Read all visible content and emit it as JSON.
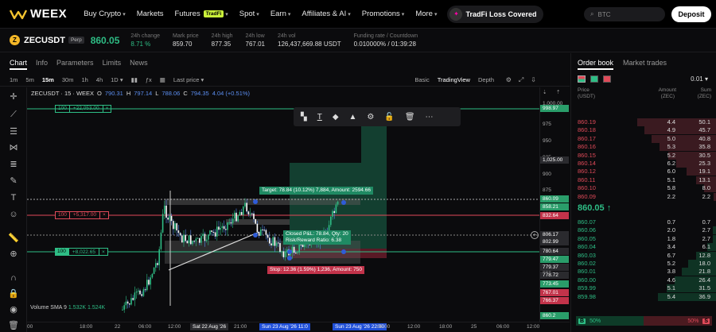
{
  "brand": {
    "name": "WEEX"
  },
  "nav": {
    "items": [
      "Buy Crypto",
      "Markets",
      "Futures",
      "Spot",
      "Earn",
      "Affiliates & AI",
      "Promotions",
      "More"
    ],
    "futures_badge": "TradFi",
    "promo": "TradFi Loss Covered",
    "search_placeholder": "BTC",
    "deposit": "Deposit"
  },
  "ticker": {
    "symbol": "ZECUSDT",
    "badge": "Perp",
    "last_price": "860.05",
    "stats": [
      {
        "label": "24h change",
        "value": "8.71 %"
      },
      {
        "label": "Mark price",
        "value": "859.70"
      },
      {
        "label": "24h high",
        "value": "877.35"
      },
      {
        "label": "24h low",
        "value": "767.01"
      },
      {
        "label": "24h vol",
        "value": "126,437,669.88 USDT"
      },
      {
        "label": "Funding rate / Countdown",
        "value": "0.010000% / 01:39:28"
      }
    ]
  },
  "chart_tabs": [
    "Chart",
    "Info",
    "Parameters",
    "Limits",
    "News"
  ],
  "toolbar": {
    "intervals": [
      "1m",
      "5m",
      "15m",
      "30m",
      "1h",
      "4h",
      "1D"
    ],
    "active_interval": "15m",
    "price_type": "Last price",
    "views": [
      "Basic",
      "TradingView",
      "Depth"
    ],
    "active_view": "TradingView"
  },
  "legend": {
    "title": "ZECUSDT · 15 · WEEX",
    "o_label": "O",
    "o": "790.31",
    "h_label": "H",
    "h": "797.14",
    "l_label": "L",
    "l": "788.06",
    "c_label": "C",
    "c": "794.35",
    "chg": "4.04 (+0.51%)"
  },
  "positions": [
    {
      "qty": "100",
      "value": "+22,053.00",
      "style": "green"
    },
    {
      "qty": "100",
      "value": "+5,317.00",
      "style": "red"
    },
    {
      "qty": "100",
      "value": "+8,022.65",
      "style": "green"
    }
  ],
  "labels": {
    "target": "Target: 78.84 (10.12%) 7,884, Amount: 2594.66",
    "closed_pl": "Closed P&L: 78.84, Qty: 20",
    "risk_reward": "Risk/Reward Ratio: 6.38",
    "stop": "Stop: 12.36 (1.59%) 1,236, Amount: 750",
    "volume": "Volume SMA 9",
    "vol1": "1.532K",
    "vol2": "1.524K"
  },
  "yaxis": {
    "ticks": [
      "1,000.00",
      "975",
      "950",
      "925",
      "900",
      "875",
      "850",
      "825",
      "800",
      "775",
      "750",
      "725"
    ],
    "tags": [
      {
        "text": "998.97",
        "color": "#2a9d6a"
      },
      {
        "text": "1,025.00",
        "color": "#2a2a2e"
      },
      {
        "text": "860.09",
        "color": "#2a9d6a"
      },
      {
        "text": "858.21",
        "color": "#2a9d6a"
      },
      {
        "text": "832.64",
        "color": "#c2334a"
      },
      {
        "text": "806.17",
        "color": "#2a2a2e"
      },
      {
        "text": "802.99",
        "color": "#2a2a2e"
      },
      {
        "text": "780.64",
        "color": "#2a2a2e"
      },
      {
        "text": "779.47",
        "color": "#2a9d6a"
      },
      {
        "text": "779.37",
        "color": "#2a2a2e"
      },
      {
        "text": "778.72",
        "color": "#2a2a2e"
      },
      {
        "text": "773.45",
        "color": "#2a9d6a"
      },
      {
        "text": "767.01",
        "color": "#c2334a"
      },
      {
        "text": "766.37",
        "color": "#c2334a"
      },
      {
        "text": "860.2",
        "color": "#2a9d6a"
      }
    ]
  },
  "xaxis": {
    "ticks": [
      "00",
      "18:00",
      "22",
      "06:00",
      "12:00",
      "21:00",
      "15:00",
      "06:00",
      "12:00",
      "18:00",
      "25",
      "06:00",
      "12:00"
    ],
    "tag_left": "Sat 22 Aug '26",
    "tag_mid": "Sun 23 Aug '26",
    "tag_time": "11:0",
    "tag_right": "Sun 23 Aug '26",
    "tag_right_time": "22:00"
  },
  "orderbook": {
    "tabs": [
      "Order book",
      "Market trades"
    ],
    "decimals": "0.01",
    "head": {
      "price": "Price",
      "price_unit": "(USDT)",
      "amount": "Amount",
      "amount_unit": "(ZEC)",
      "sum": "Sum",
      "sum_unit": "(ZEC)"
    },
    "asks": [
      {
        "p": "860.19",
        "a": "4.4",
        "s": "50.1"
      },
      {
        "p": "860.18",
        "a": "4.9",
        "s": "45.7"
      },
      {
        "p": "860.17",
        "a": "5.0",
        "s": "40.8"
      },
      {
        "p": "860.16",
        "a": "5.3",
        "s": "35.8"
      },
      {
        "p": "860.15",
        "a": "5.2",
        "s": "30.5"
      },
      {
        "p": "860.14",
        "a": "6.2",
        "s": "25.3"
      },
      {
        "p": "860.12",
        "a": "6.0",
        "s": "19.1"
      },
      {
        "p": "860.11",
        "a": "5.1",
        "s": "13.1"
      },
      {
        "p": "860.10",
        "a": "5.8",
        "s": "8.0"
      },
      {
        "p": "860.09",
        "a": "2.2",
        "s": "2.2"
      }
    ],
    "mid": "860.05 ↑",
    "bids": [
      {
        "p": "860.07",
        "a": "0.7",
        "s": "0.7"
      },
      {
        "p": "860.06",
        "a": "2.0",
        "s": "2.7"
      },
      {
        "p": "860.05",
        "a": "1.8",
        "s": "2.7"
      },
      {
        "p": "860.04",
        "a": "3.4",
        "s": "6.1"
      },
      {
        "p": "860.03",
        "a": "6.7",
        "s": "12.8"
      },
      {
        "p": "860.02",
        "a": "5.2",
        "s": "18.0"
      },
      {
        "p": "860.01",
        "a": "3.8",
        "s": "21.8"
      },
      {
        "p": "860.00",
        "a": "4.6",
        "s": "26.4"
      },
      {
        "p": "859.99",
        "a": "5.1",
        "s": "31.5"
      },
      {
        "p": "859.98",
        "a": "5.4",
        "s": "36.9"
      }
    ],
    "buy_badge": "B",
    "buy_pct": "50%",
    "sell_pct": "50%",
    "sell_badge": "S"
  },
  "colors": {
    "up": "#2ebd85",
    "down": "#e04a59",
    "accent": "#c9f03a"
  }
}
